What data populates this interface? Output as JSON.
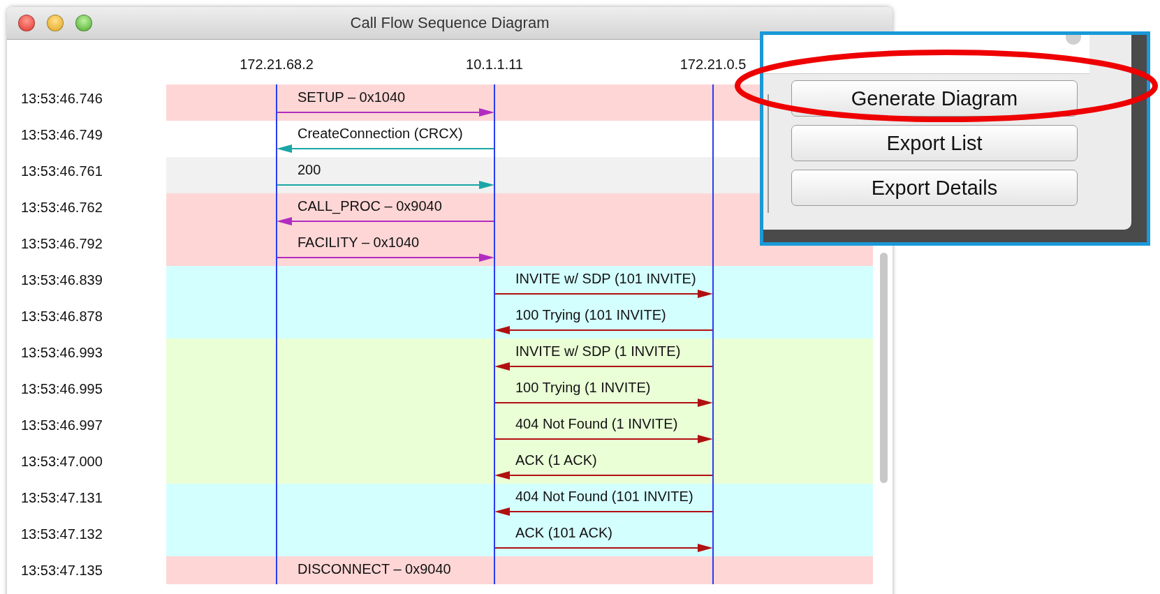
{
  "window": {
    "title": "Call Flow Sequence Diagram"
  },
  "lifelines": [
    "172.21.68.2",
    "10.1.1.11",
    "172.21.0.5"
  ],
  "messages": [
    {
      "time": "13:53:46.746",
      "label": "SETUP – 0x1040",
      "color": "#ffd6d6",
      "kind": "left",
      "arrow": {
        "color": "#b02cc0",
        "kind": "rightward"
      }
    },
    {
      "time": "13:53:46.749",
      "label": "CreateConnection (CRCX)",
      "color": "#ffffff",
      "kind": "left",
      "arrow": {
        "color": "#1aa6a6",
        "kind": "leftward"
      }
    },
    {
      "time": "13:53:46.761",
      "label": "200",
      "color": "#f1f1f1",
      "kind": "left",
      "arrow": {
        "color": "#1aa6a6",
        "kind": "rightward"
      }
    },
    {
      "time": "13:53:46.762",
      "label": "CALL_PROC – 0x9040",
      "color": "#ffd6d6",
      "kind": "left",
      "arrow": {
        "color": "#b02cc0",
        "kind": "leftward"
      }
    },
    {
      "time": "13:53:46.792",
      "label": "FACILITY – 0x1040",
      "color": "#ffd6d6",
      "kind": "left",
      "arrow": {
        "color": "#b02cc0",
        "kind": "rightward"
      }
    },
    {
      "time": "13:53:46.839",
      "label": "INVITE w/ SDP (101 INVITE)",
      "color": "#d4ffff",
      "kind": "right",
      "arrow": {
        "color": "#b01010",
        "kind": "rightward"
      }
    },
    {
      "time": "13:53:46.878",
      "label": "100 Trying (101 INVITE)",
      "color": "#d4ffff",
      "kind": "right",
      "arrow": {
        "color": "#b01010",
        "kind": "leftward"
      }
    },
    {
      "time": "13:53:46.993",
      "label": "INVITE w/ SDP (1 INVITE)",
      "color": "#eaffd6",
      "kind": "right",
      "arrow": {
        "color": "#b01010",
        "kind": "leftward"
      }
    },
    {
      "time": "13:53:46.995",
      "label": "100 Trying (1 INVITE)",
      "color": "#eaffd6",
      "kind": "right",
      "arrow": {
        "color": "#b01010",
        "kind": "rightward"
      }
    },
    {
      "time": "13:53:46.997",
      "label": "404 Not Found (1 INVITE)",
      "color": "#eaffd6",
      "kind": "right",
      "arrow": {
        "color": "#b01010",
        "kind": "rightward"
      }
    },
    {
      "time": "13:53:47.000",
      "label": "ACK (1 ACK)",
      "color": "#eaffd6",
      "kind": "right",
      "arrow": {
        "color": "#b01010",
        "kind": "leftward"
      }
    },
    {
      "time": "13:53:47.131",
      "label": "404 Not Found (101 INVITE)",
      "color": "#d4ffff",
      "kind": "right",
      "arrow": {
        "color": "#b01010",
        "kind": "leftward"
      }
    },
    {
      "time": "13:53:47.132",
      "label": "ACK (101 ACK)",
      "color": "#d4ffff",
      "kind": "right",
      "arrow": {
        "color": "#b01010",
        "kind": "rightward"
      }
    },
    {
      "time": "13:53:47.135",
      "label": "DISCONNECT – 0x9040",
      "color": "#ffd6d6",
      "kind": "left"
    }
  ],
  "callout": {
    "buttons": [
      {
        "label": "Generate Diagram",
        "circled": true
      },
      {
        "label": "Export List",
        "circled": false
      },
      {
        "label": "Export Details",
        "circled": false
      }
    ]
  }
}
